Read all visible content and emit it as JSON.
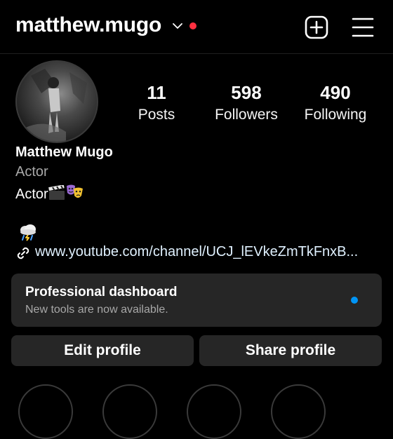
{
  "header": {
    "username": "matthew.mugo"
  },
  "stats": [
    {
      "value": "11",
      "label": "Posts"
    },
    {
      "value": "598",
      "label": "Followers"
    },
    {
      "value": "490",
      "label": "Following"
    }
  ],
  "profile": {
    "name": "Matthew Mugo",
    "category": "Actor",
    "bio_text": "Actor",
    "link": "www.youtube.com/channel/UCJ_lEVkeZmTkFnxB..."
  },
  "dashboard": {
    "title": "Professional dashboard",
    "subtitle": "New tools are now available."
  },
  "actions": {
    "edit": "Edit profile",
    "share": "Share profile"
  },
  "colors": {
    "background": "#000000",
    "card": "#262626",
    "notification_red": "#ff3040",
    "accent_blue": "#0095f6",
    "muted_text": "#a8a8a8"
  }
}
